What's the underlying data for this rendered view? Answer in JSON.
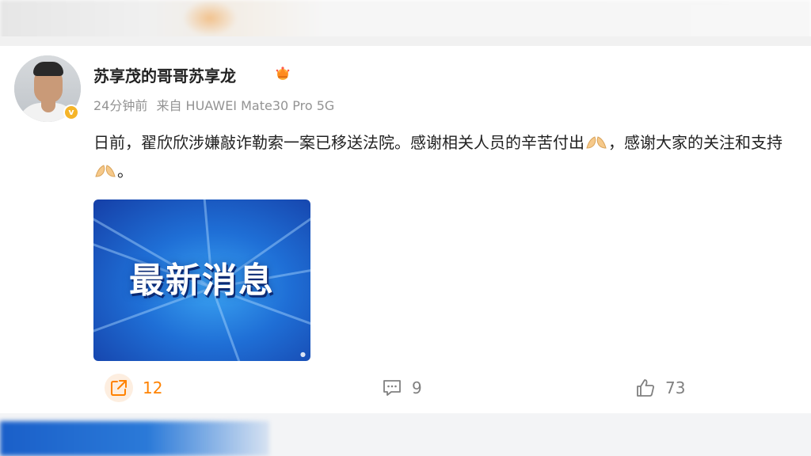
{
  "post": {
    "username": "苏享茂的哥哥苏享龙",
    "time": "24分钟前",
    "source": "来自 HUAWEI Mate30 Pro 5G",
    "content_part1": "日前，翟欣欣涉嫌敲诈勒索一案已移送法院。感谢相关人员的辛苦付出",
    "content_part2": "，感谢大家的关注和支持",
    "content_part3": "。",
    "image": {
      "title": "最新消息"
    }
  },
  "actions": {
    "repost_count": "12",
    "comment_count": "9",
    "like_count": "73"
  },
  "colors": {
    "accent_orange": "#ff8200",
    "verified_gold": "#f5b428",
    "meta_gray": "#939393"
  }
}
